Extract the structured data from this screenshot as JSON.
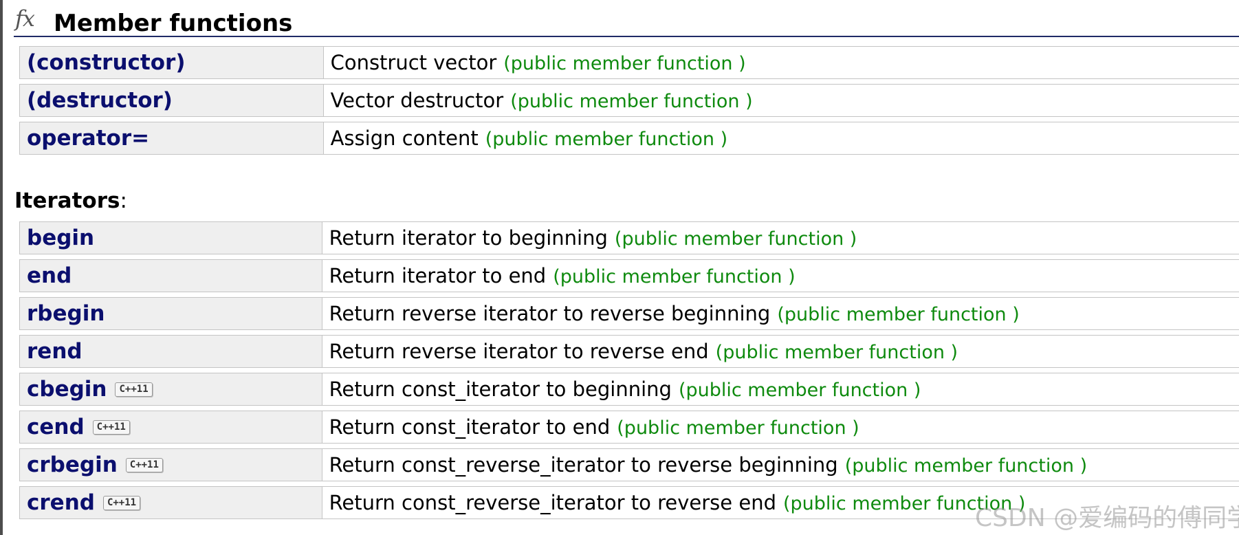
{
  "header": {
    "icon": "fx-icon",
    "icon_text": "fx",
    "title": "Member functions"
  },
  "main_functions": [
    {
      "name": "(constructor)",
      "description": "Construct vector",
      "kind": "(public member function )",
      "cpp11": false
    },
    {
      "name": "(destructor)",
      "description": "Vector destructor",
      "kind": "(public member function )",
      "cpp11": false
    },
    {
      "name": "operator=",
      "description": "Assign content",
      "kind": "(public member function )",
      "cpp11": false
    }
  ],
  "iterators": {
    "heading": "Iterators",
    "suffix": ":",
    "functions": [
      {
        "name": "begin",
        "description": "Return iterator to beginning",
        "kind": "(public member function )",
        "cpp11": false
      },
      {
        "name": "end",
        "description": "Return iterator to end",
        "kind": "(public member function )",
        "cpp11": false
      },
      {
        "name": "rbegin",
        "description": "Return reverse iterator to reverse beginning",
        "kind": "(public member function )",
        "cpp11": false
      },
      {
        "name": "rend",
        "description": "Return reverse iterator to reverse end",
        "kind": "(public member function )",
        "cpp11": false
      },
      {
        "name": "cbegin",
        "description": "Return const_iterator to beginning",
        "kind": "(public member function )",
        "cpp11": true
      },
      {
        "name": "cend",
        "description": "Return const_iterator to end",
        "kind": "(public member function )",
        "cpp11": true
      },
      {
        "name": "crbegin",
        "description": "Return const_reverse_iterator to reverse beginning",
        "kind": "(public member function )",
        "cpp11": true
      },
      {
        "name": "crend",
        "description": "Return const_reverse_iterator to reverse end",
        "kind": "(public member function )",
        "cpp11": true
      }
    ]
  },
  "badge_label": "C++11",
  "watermark": "CSDN @爱编码的傅同学",
  "colors": {
    "function_name": "#0b0f6e",
    "kind_text": "#0e8a0e",
    "name_cell_bg": "#efefef",
    "header_rule": "#1f2a66"
  }
}
